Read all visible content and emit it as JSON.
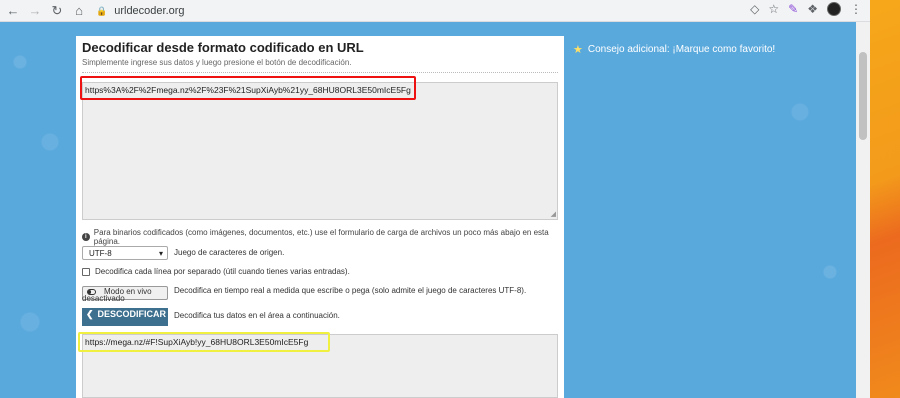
{
  "browser": {
    "url": "urldecoder.org",
    "icons": [
      "back-icon",
      "forward-icon",
      "reload-icon",
      "home-icon",
      "lock-icon",
      "translate-icon",
      "bookmark-star-icon",
      "pen-extension-icon",
      "puzzle-extension-icon",
      "profile-avatar",
      "menu-dots-icon"
    ]
  },
  "page": {
    "title": "Decodificar desde formato codificado en URL",
    "subtitle": "Simplemente ingrese sus datos y luego presione el botón de decodificación.",
    "input_value": "https%3A%2F%2Fmega.nz%2F%23F%21SupXiAyb%21yy_68HU8ORL3E50mIcE5Fg",
    "info_text": "Para binarios codificados (como imágenes, documentos, etc.) use el formulario de carga de archivos un poco más abajo en esta página.",
    "charset_value": "UTF-8",
    "charset_label": "Juego de caracteres de origen.",
    "line_by_line_label": "Decodifica cada línea por separado (útil cuando tienes varias entradas).",
    "live_mode_label": "Modo en vivo",
    "live_mode_overflow": "desactivado",
    "live_mode_desc": "Decodifica en tiempo real a medida que escribe o pega (solo admite el juego de caracteres UTF-8).",
    "decode_button": "DESCODIFICAR",
    "decode_desc": "Decodifica tus datos en el área a continuación.",
    "output_value": "https://mega.nz/#F!SupXiAyb!yy_68HU8ORL3E50mIcE5Fg"
  },
  "sidebar": {
    "tip": "Consejo adicional: ¡Marque como favorito!"
  },
  "colors": {
    "background": "#5aa9dd",
    "button": "#3d6f8e",
    "highlight_input": "#e11111",
    "highlight_output": "#f0f040"
  }
}
